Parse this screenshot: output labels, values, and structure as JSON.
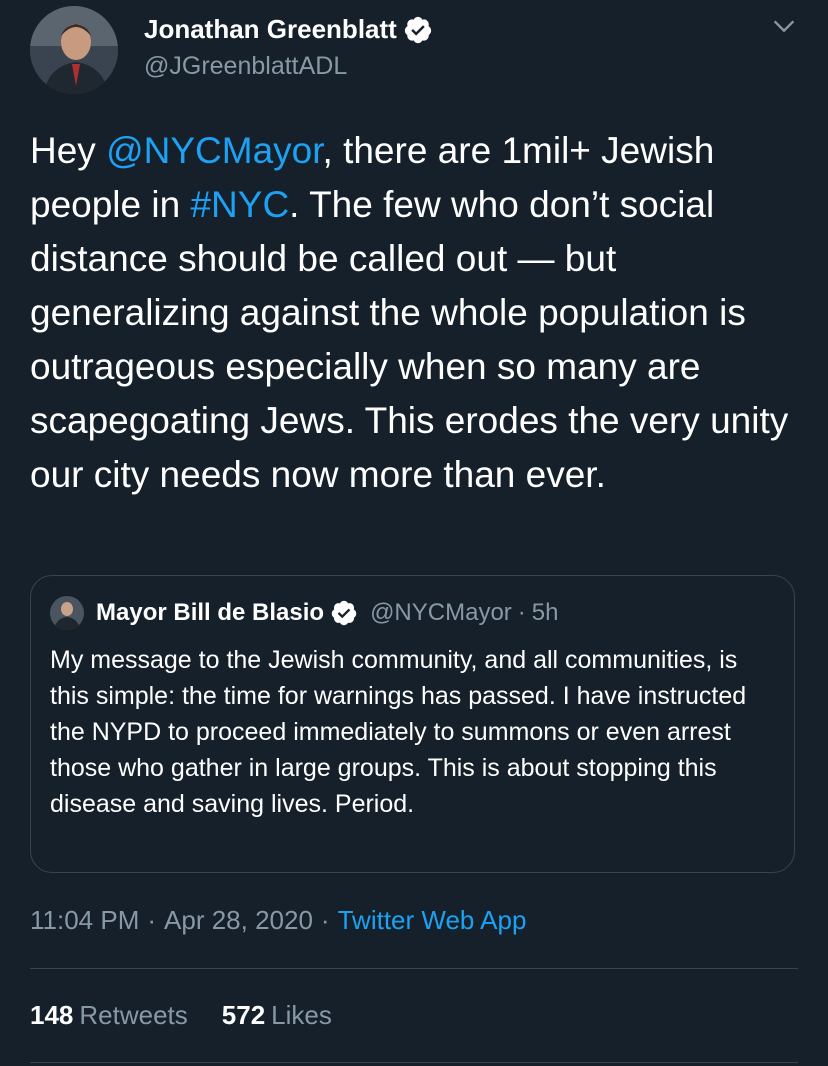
{
  "author": {
    "name": "Jonathan Greenblatt",
    "handle": "@JGreenblattADL"
  },
  "tweet": {
    "parts": [
      {
        "type": "text",
        "value": "Hey "
      },
      {
        "type": "link",
        "value": "@NYCMayor"
      },
      {
        "type": "text",
        "value": ", there are 1mil+ Jewish people in "
      },
      {
        "type": "link",
        "value": "#NYC"
      },
      {
        "type": "text",
        "value": ". The few who don’t social distance should be called out — but generalizing against the whole population is outrageous especially when so many are scapegoating Jews. This erodes the very unity our city needs now more than ever."
      }
    ]
  },
  "quoted": {
    "name": "Mayor Bill de Blasio",
    "handle": "@NYCMayor",
    "separator": "·",
    "time": "5h",
    "text": "My message to the Jewish community, and all communities, is this simple: the time for warnings has passed. I have instructed the NYPD to proceed immediately to summons or even arrest those who gather in large groups. This is about stopping this disease and saving lives. Period."
  },
  "meta": {
    "time": "11:04 PM",
    "separator": "·",
    "date": "Apr 28, 2020",
    "app": "Twitter Web App"
  },
  "stats": {
    "retweets_count": "148",
    "retweets_label": "Retweets",
    "likes_count": "572",
    "likes_label": "Likes"
  },
  "icons": {
    "verified": "verified-badge-icon",
    "menu": "chevron-down-icon"
  },
  "colors": {
    "background": "#15202b",
    "link": "#1da1f2",
    "secondary_text": "#8899a6",
    "border": "#38444d"
  }
}
